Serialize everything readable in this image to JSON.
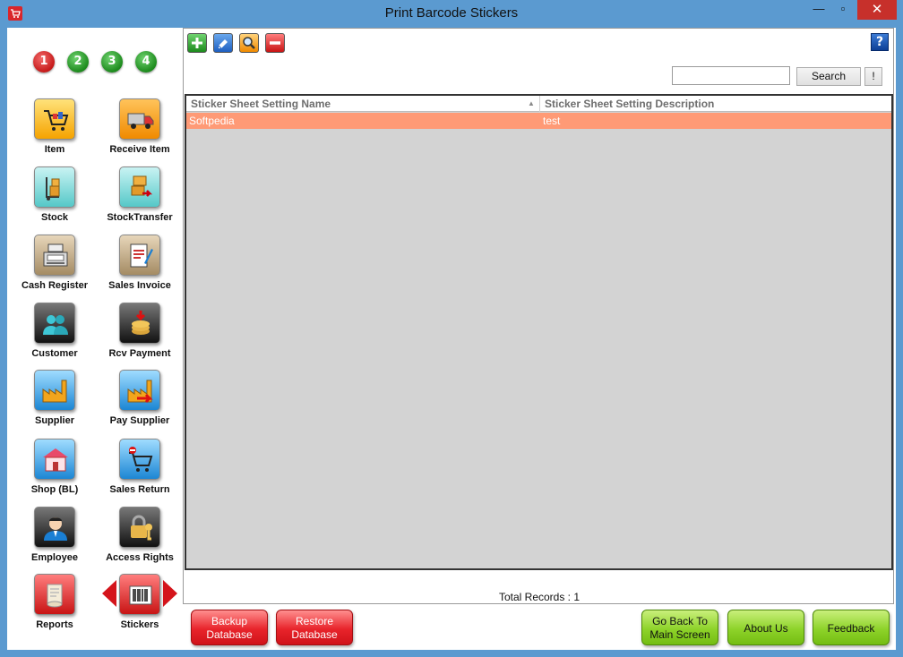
{
  "window": {
    "title": "Print Barcode Stickers",
    "minimize": "—",
    "maximize": "▫",
    "close": "✕"
  },
  "steps": [
    "1",
    "2",
    "3",
    "4"
  ],
  "nav": {
    "item": "Item",
    "receive_item": "Receive Item",
    "stock": "Stock",
    "stock_transfer": "StockTransfer",
    "cash_register": "Cash Register",
    "sales_invoice": "Sales Invoice",
    "customer": "Customer",
    "rcv_payment": "Rcv Payment",
    "supplier": "Supplier",
    "pay_supplier": "Pay Supplier",
    "shop": "Shop (BL)",
    "sales_return": "Sales Return",
    "employee": "Employee",
    "access_rights": "Access Rights",
    "reports": "Reports",
    "stickers": "Stickers"
  },
  "toolbar": {
    "help": "?"
  },
  "search": {
    "value": "",
    "placeholder": "",
    "button": "Search",
    "clear": "!"
  },
  "grid": {
    "columns": [
      "Sticker Sheet Setting Name",
      "Sticker Sheet Setting Description"
    ],
    "sort_indicator": "▲",
    "rows": [
      {
        "name": "Softpedia",
        "description": "test"
      }
    ]
  },
  "total_records": "Total Records : 1",
  "buttons": {
    "backup_l1": "Backup",
    "backup_l2": "Database",
    "restore_l1": "Restore",
    "restore_l2": "Database",
    "goback_l1": "Go Back To",
    "goback_l2": "Main Screen",
    "about": "About Us",
    "feedback": "Feedback"
  },
  "colors": {
    "accent": "#5b9ad0",
    "selected_row": "#ff9a76",
    "grid_bg": "#d3d3d3"
  }
}
